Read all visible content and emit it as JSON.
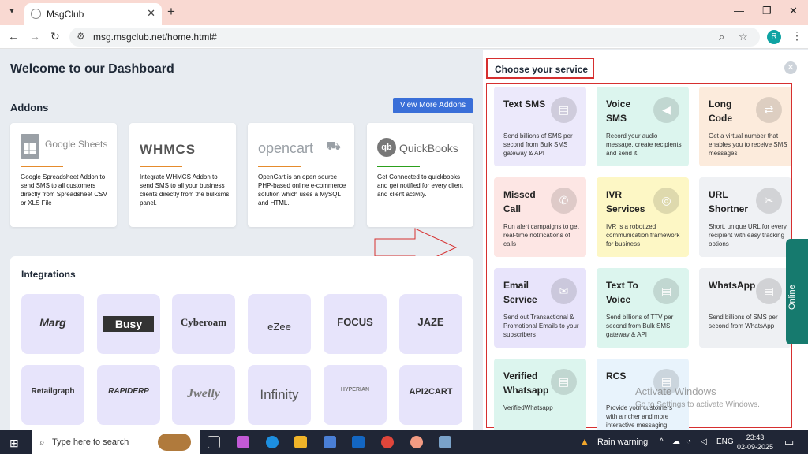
{
  "browser": {
    "tab_title": "MsgClub",
    "url": "msg.msgclub.net/home.html#",
    "profile_initial": "R"
  },
  "dashboard": {
    "welcome": "Welcome to our Dashboard",
    "addons_title": "Addons",
    "view_more_label": "View More Addons",
    "addons": [
      {
        "logo": "Google Sheets",
        "desc": "Google Spreadsheet Addon to send SMS to all customers directly from Spreadsheet CSV or XLS File"
      },
      {
        "logo": "WHMCS",
        "desc": "Integrate WHMCS Addon to send SMS to all your business clients directly from the bulksms panel."
      },
      {
        "logo": "opencart",
        "desc": "OpenCart is an open source PHP-based online e-commerce solution which uses a MySQL and HTML."
      },
      {
        "logo": "QuickBooks",
        "desc": "Get Connected to quickbooks and get notified for every client and client activity."
      }
    ],
    "integrations_title": "Integrations",
    "integrations": [
      "Marg",
      "Busy",
      "Cyberoam",
      "eZee",
      "FOCUS",
      "JAZE",
      "Retailgraph",
      "RAPIDERP",
      "Jwelly",
      "Infinity",
      "HYPERIAN",
      "API2CART"
    ]
  },
  "services": {
    "title": "Choose your service",
    "items": [
      {
        "name": "Text SMS",
        "desc": "Send billions of SMS per second from Bulk SMS gateway & API",
        "color": "#ece9fb",
        "icon": "chat-icon"
      },
      {
        "name": "Voice SMS",
        "desc": "Record your audio message, create recipients and send it.",
        "color": "#dcf5ee",
        "icon": "megaphone-icon"
      },
      {
        "name": "Long Code",
        "desc": "Get a virtual number that enables you to receive SMS messages",
        "color": "#fcebdc",
        "icon": "signpost-icon"
      },
      {
        "name": "Missed Call",
        "desc": "Run alert campaigns to get real-time notifications of calls",
        "color": "#fde6e4",
        "icon": "phone-icon"
      },
      {
        "name": "IVR Services",
        "desc": "IVR is a robotized communication framework for business",
        "color": "#fdf7c5",
        "icon": "ivr-icon"
      },
      {
        "name": "URL Shortner",
        "desc": "Short, unique URL for every recipient with easy tracking options",
        "color": "#eff1f4",
        "icon": "scissors-icon"
      },
      {
        "name": "Email Service",
        "desc": "Send out Transactional & Promotional Emails to your subscribers",
        "color": "#e8e4fb",
        "icon": "envelope-icon"
      },
      {
        "name": "Text To Voice",
        "desc": "Send billions of TTV per second from Bulk SMS gateway & API",
        "color": "#dcf5ee",
        "icon": "chat-icon"
      },
      {
        "name": "WhatsApp",
        "desc": "Send billions of SMS per second from WhatsApp",
        "color": "#eef0f3",
        "icon": "chat-icon"
      },
      {
        "name": "Verified Whatsapp",
        "desc": "VerifiedWhatsapp",
        "color": "#dcf5ee",
        "icon": "chat-icon"
      },
      {
        "name": "RCS",
        "desc": "Provide your customers with a richer and more interactive messaging",
        "color": "#e8f3fc",
        "icon": "chat-icon"
      }
    ]
  },
  "watermark": {
    "line1": "Activate Windows",
    "line2": "Go to Settings to activate Windows."
  },
  "online_label": "Online",
  "taskbar": {
    "search_placeholder": "Type here to search",
    "weather": "Rain warning",
    "lang": "ENG",
    "time": "23:43",
    "date": "02-09-2025"
  }
}
